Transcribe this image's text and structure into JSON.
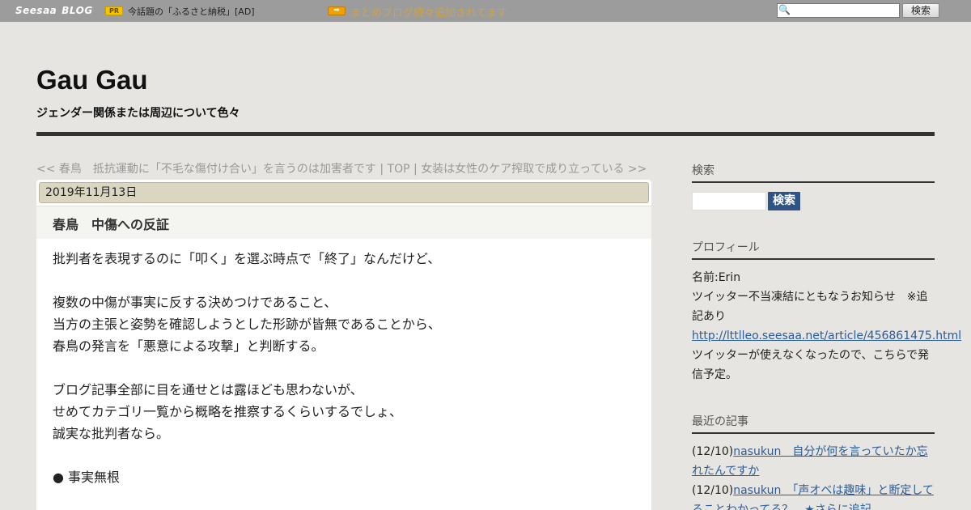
{
  "topbar": {
    "logo_seesaa": "Seesaa",
    "logo_blog": "BLOG",
    "pr_badge": "PR",
    "pr_text": "今話題の「ふるさと納税」[AD]",
    "arrow_icon": "arrow-right-icon",
    "promo_text": "まとめブログ続々追加されてます",
    "search_placeholder": "",
    "search_button": "検索"
  },
  "header": {
    "title": "Gau Gau",
    "description": "ジェンダー関係または周辺について色々"
  },
  "article_nav": {
    "prev": "<< 春鳥　抵抗運動に「不毛な傷付け合い」を言うのは加害者です",
    "sep1": " | ",
    "top": "TOP",
    "sep2": " | ",
    "next": "女装は女性のケア搾取で成り立っている >>"
  },
  "article": {
    "date": "2019年11月13日",
    "title": "春鳥　中傷への反証",
    "lines": [
      "批判者を表現するのに「叩く」を選ぶ時点で「終了」なんだけど、",
      "",
      "複数の中傷が事実に反する決めつけであること、",
      "当方の主張と姿勢を確認しようとした形跡が皆無であることから、",
      "春鳥の発言を「悪意による攻撃」と判断する。",
      "",
      "ブログ記事全部に目を通せとは露ほども思わないが、",
      "せめてカテゴリ一覧から概略を推察するくらいするでしょ、",
      "誠実な批判者なら。",
      "",
      "● 事実無根"
    ]
  },
  "sidebar": {
    "search": {
      "heading": "検索",
      "button": "検索"
    },
    "profile": {
      "heading": "プロフィール",
      "name": "名前:Erin",
      "notice": "ツイッター不当凍結にともなうお知らせ　※追記あり",
      "link": "http://lttlleo.seesaa.net/article/456861475.html",
      "after_link": "ツイッターが使えなくなったので、こちらで発信予定。"
    },
    "recent": {
      "heading": "最近の記事",
      "items": [
        {
          "date": "(12/10)",
          "title": "nasukun　自分が何を言っていたか忘れたんですか"
        },
        {
          "date": "(12/10)",
          "title": "nasukun　「声オベは趣味」と断定してることわかってる？　★さらに追記"
        }
      ]
    }
  },
  "colors": {
    "topbar_bg": "#9c9c9c",
    "page_bg": "#e6e5e1",
    "date_bar_bg": "#dbd6c1",
    "link": "#2b5c99",
    "sidebar_button_bg": "#2f5386",
    "promo_text": "#c9a44c"
  }
}
